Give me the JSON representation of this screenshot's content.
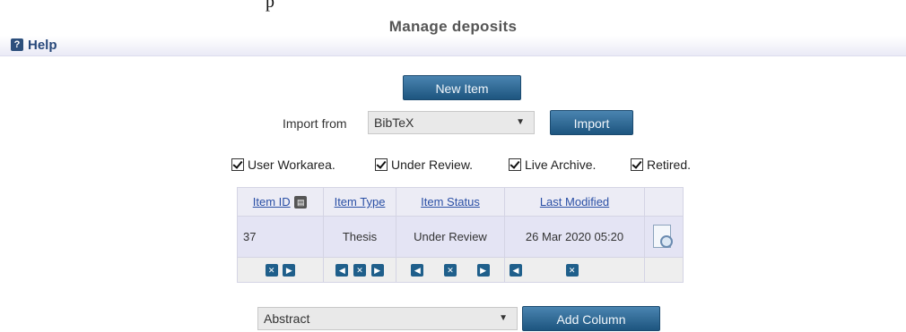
{
  "top_text": "p",
  "title": "Manage deposits",
  "help": {
    "label": "Help"
  },
  "new_item_label": "New Item",
  "import": {
    "label": "Import from",
    "selected": "BibTeX",
    "button_label": "Import"
  },
  "filters": [
    {
      "label": "User Workarea.",
      "checked": true
    },
    {
      "label": "Under Review.",
      "checked": true
    },
    {
      "label": "Live Archive.",
      "checked": true
    },
    {
      "label": "Retired.",
      "checked": true
    }
  ],
  "table": {
    "headers": [
      "Item ID",
      "Item Type",
      "Item Status",
      "Last Modified"
    ],
    "row": {
      "item_id": "37",
      "item_type": "Thesis",
      "item_status": "Under Review",
      "last_modified": "26 Mar 2020 05:20"
    }
  },
  "column_select": {
    "selected": "Abstract",
    "button_label": "Add Column"
  },
  "icons": {
    "help": "help-book-icon",
    "view": "view-item-icon",
    "remove": "remove-column-icon",
    "left": "move-left-icon",
    "right": "move-right-icon"
  },
  "colors": {
    "button": "#2a628e",
    "link": "#2a4fa5",
    "title": "#555555",
    "row_bg": "#e4e4f4"
  }
}
